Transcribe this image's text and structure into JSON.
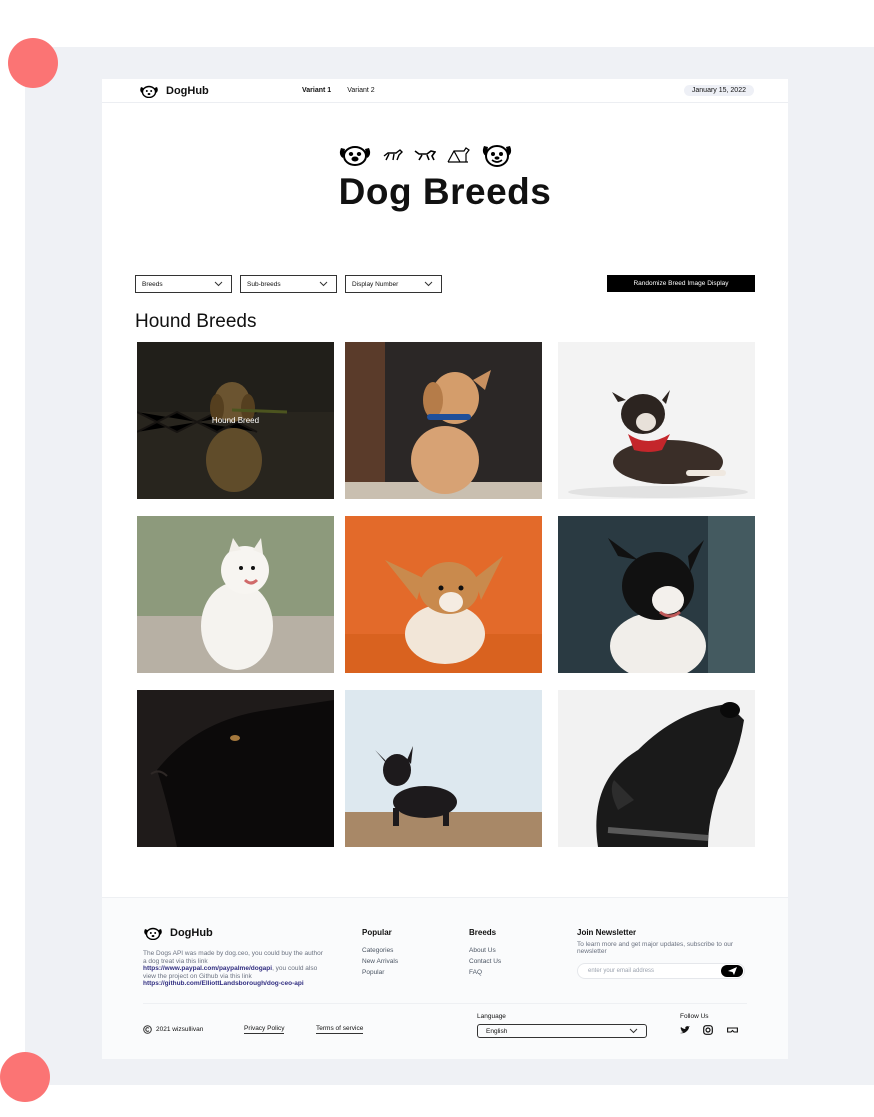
{
  "brand": {
    "name": "DogHub"
  },
  "nav": {
    "items": [
      "Variant 1",
      "Variant 2"
    ]
  },
  "header": {
    "date": "January 15, 2022"
  },
  "hero": {
    "title": "Dog Breeds"
  },
  "filters": {
    "breeds": "Breeds",
    "sub_breeds": "Sub-breeds",
    "display_number": "Display Number",
    "randomize_button": "Randomize Breed Image Display"
  },
  "section": {
    "title": "Hound Breeds"
  },
  "gallery": {
    "hover_label": "Hound Breed"
  },
  "footer": {
    "about_plain_1": "The Dogs API was made by dog.ceo, you could buy the author a dog treat via this link ",
    "about_link_1": "https://www.paypal.com/paypalme/dogapi",
    "about_plain_2": ", you could also view the project on Github via this link ",
    "about_link_2": "https://github.com/ElliottLandsborough/dog-ceo-api",
    "popular": {
      "title": "Popular",
      "links": [
        "Categories",
        "New Arrivals",
        "Popular"
      ]
    },
    "breeds": {
      "title": "Breeds",
      "links": [
        "About Us",
        "Contact Us",
        "FAQ"
      ]
    },
    "newsletter": {
      "title": "Join Newsletter",
      "text": "To learn more and get major updates, subscribe to our newsletter",
      "placeholder": "enter your email address"
    },
    "copyright": "2021 wizsullivan",
    "privacy": "Privacy Policy",
    "terms": "Terms of service",
    "language": {
      "label": "Language",
      "value": "English"
    },
    "follow": {
      "label": "Follow Us",
      "icons": [
        "twitter-icon",
        "instagram-icon",
        "vr-icon"
      ]
    }
  },
  "colors": {
    "accent_dot": "#fb7474",
    "backdrop": "#eff1f5",
    "link": "#312e81"
  }
}
